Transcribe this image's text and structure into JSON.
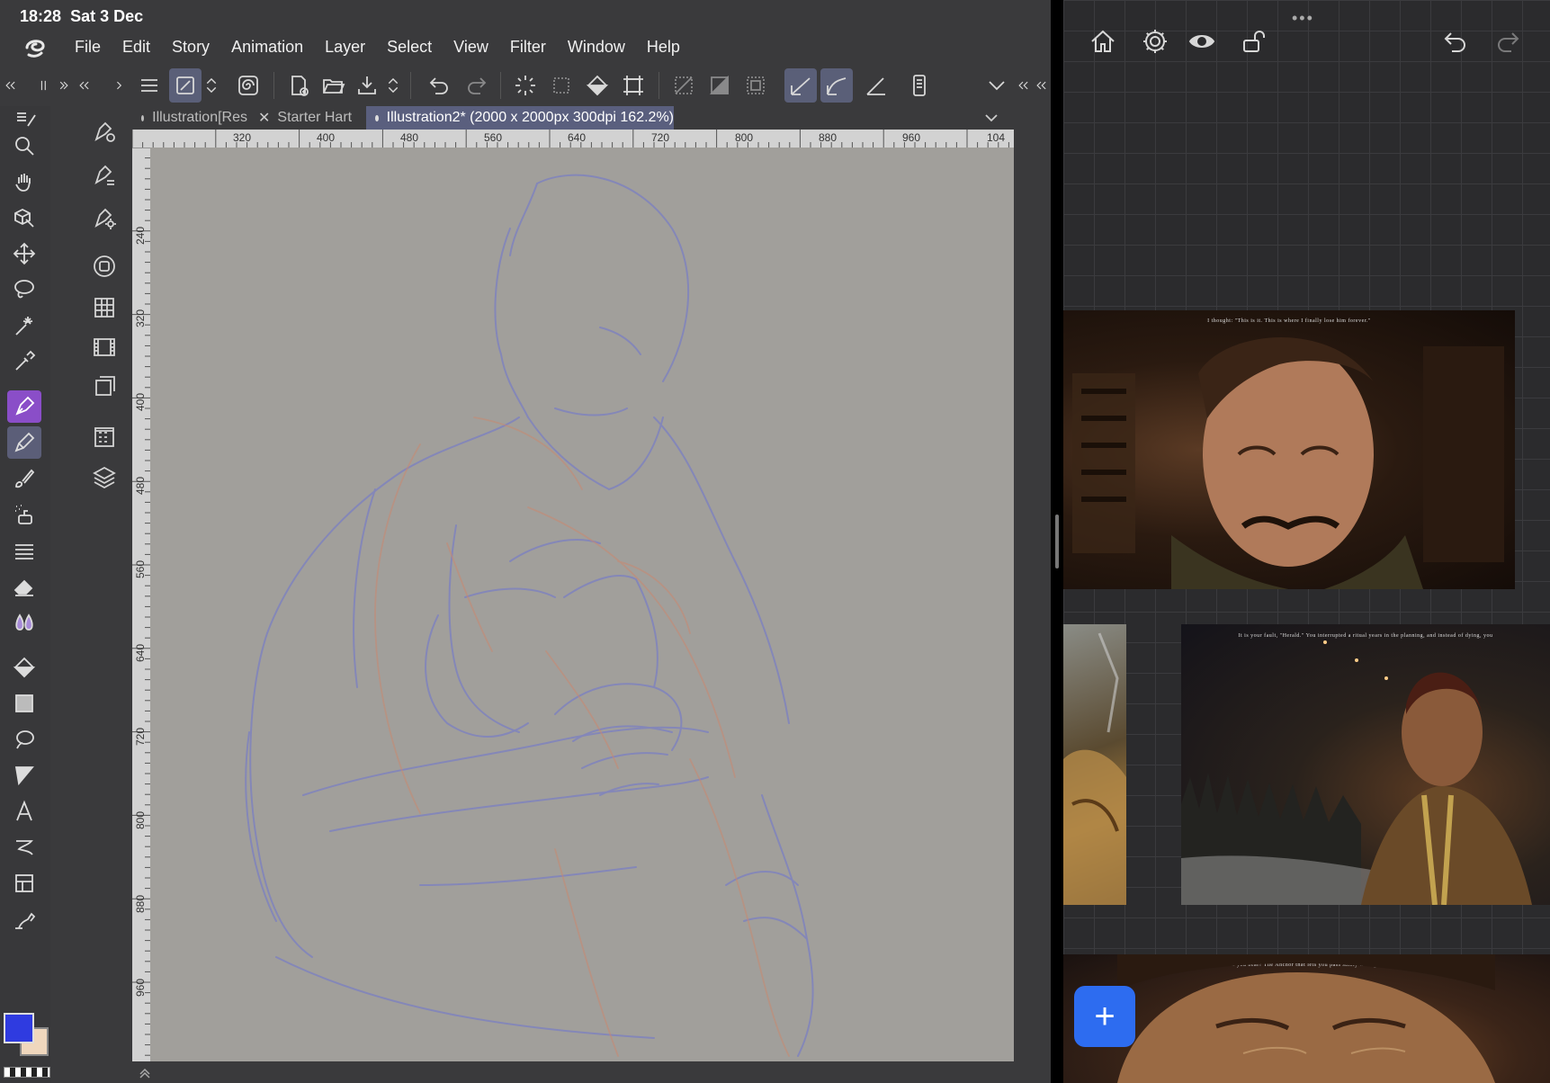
{
  "status": {
    "time": "18:28",
    "date": "Sat 3 Dec"
  },
  "menu": [
    "File",
    "Edit",
    "Story",
    "Animation",
    "Layer",
    "Select",
    "View",
    "Filter",
    "Window",
    "Help"
  ],
  "tabs": [
    {
      "label": "Illustration[Res",
      "active": false
    },
    {
      "label": "Starter Hart",
      "active": false
    },
    {
      "label": "Illustration2* (2000 x 2000px 300dpi 162.2%)",
      "active": true
    }
  ],
  "ruler": {
    "top": [
      "320",
      "400",
      "480",
      "560",
      "640",
      "720",
      "800",
      "880",
      "960",
      "104"
    ],
    "left": [
      "240",
      "320",
      "400",
      "480",
      "560",
      "640",
      "720",
      "800",
      "880",
      "960"
    ]
  },
  "colors": {
    "main": "#2f3be0",
    "sub": "#efd7bd",
    "accent": "#8a4ec8",
    "fab": "#2d6cf0"
  },
  "board": {
    "fab_label": "+",
    "captions": [
      "I thought: \"This is it. This is where I finally lose him forever.\"",
      "It is your fault, \"Herald.\" You interrupted a ritual years in the planning, and instead of dying, you",
      "That mark you bear? The Anchor that lets you pass safely through the Veil?"
    ]
  }
}
